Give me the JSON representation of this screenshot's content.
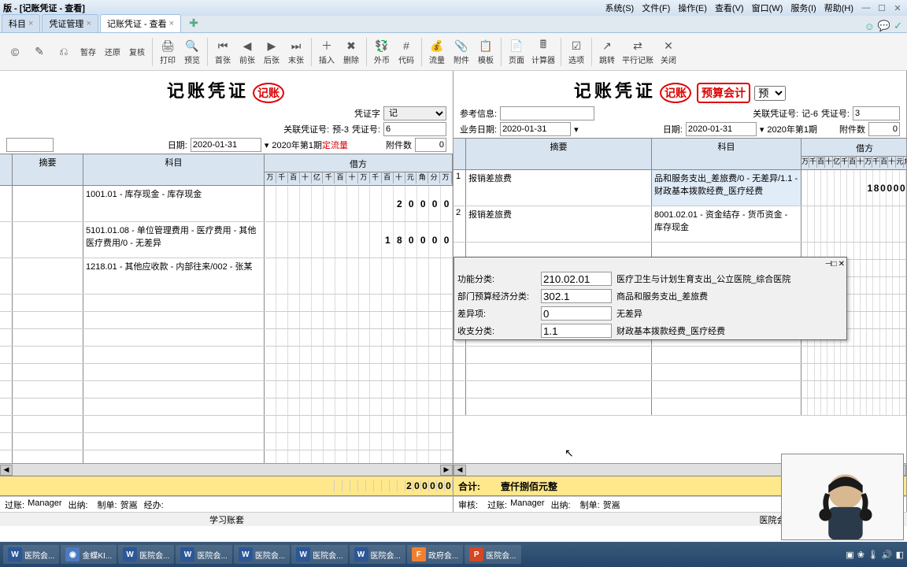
{
  "window": {
    "title": "版 - [记账凭证 - 查看]"
  },
  "menu": [
    "系统(S)",
    "文件(F)",
    "操作(E)",
    "查看(V)",
    "窗口(W)",
    "服务(I)",
    "帮助(H)"
  ],
  "tabs": [
    {
      "label": "科目",
      "active": false
    },
    {
      "label": "凭证管理",
      "active": false
    },
    {
      "label": "记账凭证 - 查看",
      "active": true
    }
  ],
  "toolbar": [
    {
      "icon": "©",
      "label": ""
    },
    {
      "icon": "✎",
      "label": ""
    },
    {
      "icon": "⎌",
      "label": ""
    },
    {
      "label": "暂存"
    },
    {
      "label": "还原"
    },
    {
      "label": "复核"
    },
    {
      "sep": true
    },
    {
      "icon": "🖨",
      "label": "打印"
    },
    {
      "icon": "🔍",
      "label": "预览"
    },
    {
      "sep": true
    },
    {
      "icon": "⏮",
      "label": "首张"
    },
    {
      "icon": "◀",
      "label": "前张"
    },
    {
      "icon": "▶",
      "label": "后张"
    },
    {
      "icon": "⏭",
      "label": "末张"
    },
    {
      "sep": true
    },
    {
      "icon": "＋",
      "label": "插入"
    },
    {
      "icon": "✖",
      "label": "删除"
    },
    {
      "sep": true
    },
    {
      "icon": "💱",
      "label": "外币"
    },
    {
      "icon": "#",
      "label": "代码"
    },
    {
      "sep": true
    },
    {
      "icon": "💰",
      "label": "流量"
    },
    {
      "icon": "📎",
      "label": "附件"
    },
    {
      "icon": "📋",
      "label": "模板"
    },
    {
      "sep": true
    },
    {
      "icon": "📄",
      "label": "页面"
    },
    {
      "icon": "🖩",
      "label": "计算器"
    },
    {
      "sep": true
    },
    {
      "icon": "☑",
      "label": "选项"
    },
    {
      "sep": true
    },
    {
      "icon": "↗",
      "label": "跳转"
    },
    {
      "icon": "⇄",
      "label": "平行记账"
    },
    {
      "icon": "✕",
      "label": "关闭"
    }
  ],
  "left": {
    "title": "记账凭证",
    "stamps": [
      "记账"
    ],
    "field_labels": {
      "word": "凭证字",
      "rel": "关联凭证号:",
      "num": "凭证号:",
      "date": "日期:",
      "period_suffix": "定流量",
      "att": "附件数"
    },
    "word": "记",
    "rel_no": "预-3",
    "num": "6",
    "date": "2020-01-31",
    "period": "2020年第1期",
    "attachments": "0",
    "cols": {
      "summary": "摘要",
      "subject": "科目",
      "debit": "借方"
    },
    "units": "万千百十亿千百十万千百十元角分万",
    "rows": [
      {
        "num": "",
        "summary": "",
        "subject": "1001.01 - 库存现金 - 库存现金",
        "amount": "20000"
      },
      {
        "num": "",
        "summary": "",
        "subject": "5101.01.08 - 单位管理费用 - 医疗费用 - 其他医疗费用/0 - 无差异",
        "amount": "180000"
      },
      {
        "num": "",
        "summary": "",
        "subject": "1218.01 - 其他应收款 - 内部往来/002 - 张某",
        "amount": ""
      }
    ],
    "total": {
      "label": "",
      "amount": "200000"
    },
    "sigs": {
      "过账": "Manager",
      "出纳": "",
      "制单": "贺嵩",
      "经办": ""
    },
    "status_right": "学习账套"
  },
  "right": {
    "title": "记账凭证",
    "stamps": [
      "记账",
      "预算会计"
    ],
    "field_labels": {
      "ref": "参考信息:",
      "rel": "关联凭证号:",
      "num": "凭证号:",
      "biz": "业务日期:",
      "date": "日期:",
      "period_suffix": "",
      "att": "附件数",
      "word": "预"
    },
    "ref": "",
    "rel_no": "记-6",
    "num": "3",
    "biz_date": "2020-01-31",
    "date": "2020-01-31",
    "period": "2020年第1期",
    "attachments": "0",
    "cols": {
      "summary": "摘要",
      "subject": "科目",
      "debit": "借方"
    },
    "units": "万千百十亿千百十万千百十元角分万",
    "rows": [
      {
        "num": "1",
        "summary": "报销差旅费",
        "subject": "品和服务支出_差旅费/0 - 无差异/1.1 - 财政基本拨款经费_医疗经费",
        "amount": "180000",
        "hl": true
      },
      {
        "num": "2",
        "summary": "报销差旅费",
        "subject": "8001.02.01 - 资金结存 - 货币资金 - 库存现金",
        "amount": ""
      }
    ],
    "total": {
      "label": "合计:",
      "text": "壹仟捌佰元整"
    },
    "sigs": {
      "审核": "",
      "过账": "Manager",
      "出纳": "",
      "制单": "贺嵩"
    },
    "status": "医院会计学习账套    账务处理：2020年"
  },
  "popup": {
    "rows": [
      {
        "label": "功能分类:",
        "value": "210.02.01",
        "desc": "医疗卫生与计划生育支出_公立医院_综合医院"
      },
      {
        "label": "部门预算经济分类:",
        "value": "302.1",
        "desc": "商品和服务支出_差旅费"
      },
      {
        "label": "差异项:",
        "value": "0",
        "desc": "无差异"
      },
      {
        "label": "收支分类:",
        "value": "1.1",
        "desc": "财政基本拨款经费_医疗经费"
      }
    ]
  },
  "taskbar": [
    {
      "icon": "W",
      "cls": "w",
      "label": "医院会..."
    },
    {
      "icon": "◉",
      "cls": "",
      "label": "金蝶KI..."
    },
    {
      "icon": "W",
      "cls": "w",
      "label": "医院会..."
    },
    {
      "icon": "W",
      "cls": "w",
      "label": "医院会..."
    },
    {
      "icon": "W",
      "cls": "w",
      "label": "医院会..."
    },
    {
      "icon": "W",
      "cls": "w",
      "label": "医院会..."
    },
    {
      "icon": "W",
      "cls": "w",
      "label": "医院会..."
    },
    {
      "icon": "F",
      "cls": "f",
      "label": "政府会..."
    },
    {
      "icon": "P",
      "cls": "p",
      "label": "医院会..."
    }
  ],
  "tray": [
    "▣",
    "❀",
    "🌡",
    "🔊",
    "◧"
  ]
}
